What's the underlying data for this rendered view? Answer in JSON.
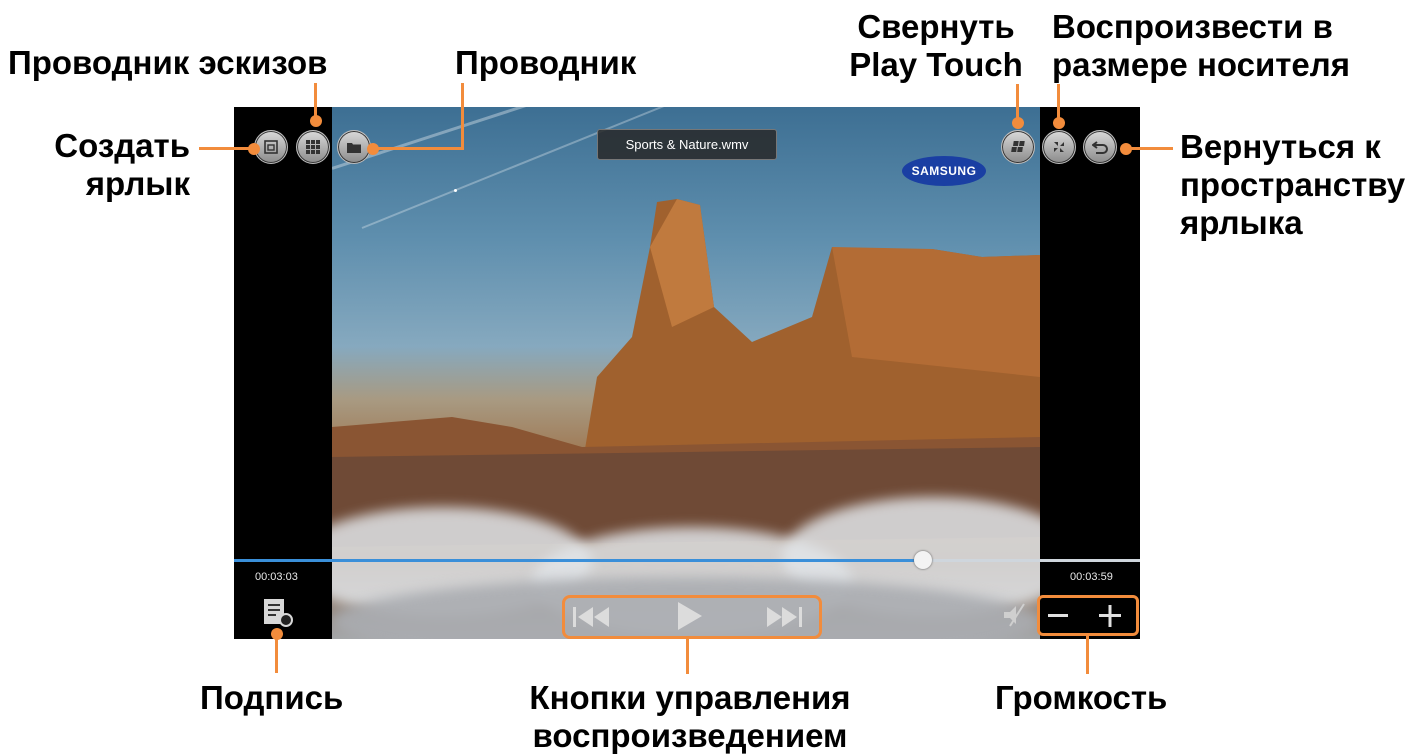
{
  "player": {
    "file_title": "Sports & Nature.wmv",
    "brand_logo": "SAMSUNG",
    "elapsed_time": "00:03:03",
    "total_time": "00:03:59",
    "progress_fraction": 0.76
  },
  "callouts": {
    "create_shortcut": "Создать ярлык",
    "thumbnail_explorer": "Проводник эскизов",
    "explorer": "Проводник",
    "minimize": "Свернуть Play Touch",
    "play_media_size": "Воспроизвести в размере носителя",
    "return_shortcut": "Вернуться к пространству ярлыка",
    "caption": "Подпись",
    "playback_controls": "Кнопки управления воспроизведением",
    "volume": "Громкость"
  },
  "icons": [
    "shortcut-icon",
    "grid-icon",
    "folder-icon",
    "windows-icon",
    "shrink-icon",
    "back-arrow-icon",
    "caption-icon",
    "previous-icon",
    "play-icon",
    "next-icon",
    "mute-icon",
    "volume-down-icon",
    "volume-up-icon"
  ],
  "colors": {
    "accent": "#f28c3c",
    "progress": "#3a8fd9",
    "player_bg": "#000000"
  }
}
